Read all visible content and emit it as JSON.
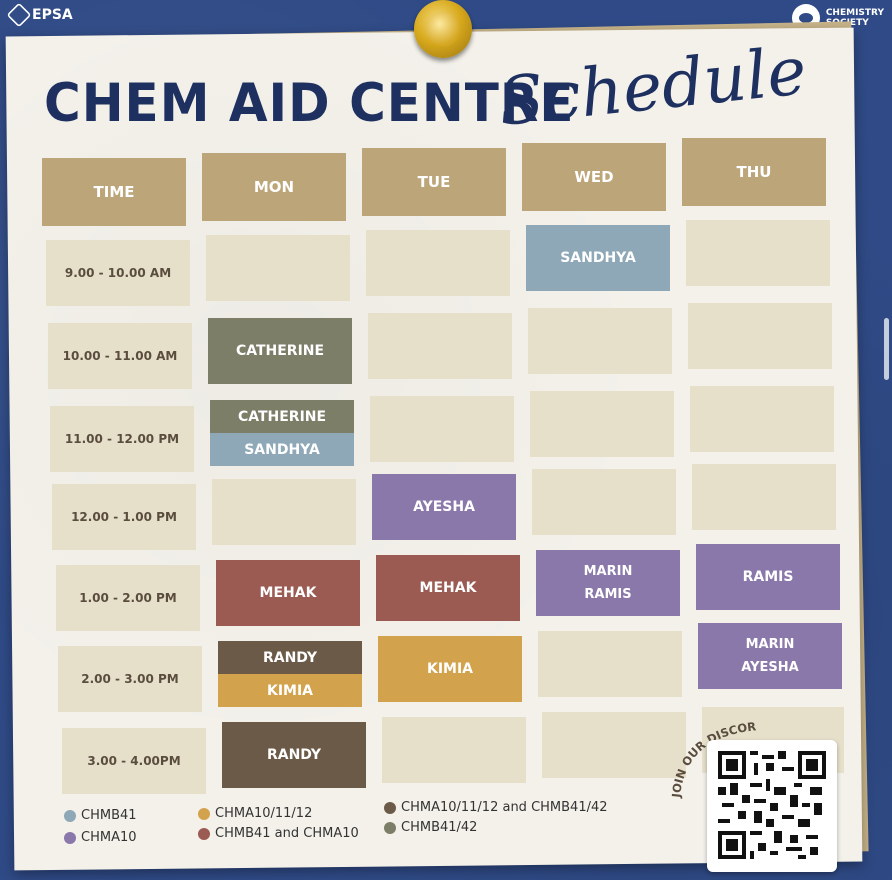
{
  "logos": {
    "left": "EPSA",
    "right_line1": "CHEMISTRY",
    "right_line2": "SOCIETY"
  },
  "title": {
    "main": "CHEM AID CENTRE",
    "script": "Schedule"
  },
  "headers": [
    "TIME",
    "MON",
    "TUE",
    "WED",
    "THU"
  ],
  "times": [
    "9.00 - 10.00 AM",
    "10.00 - 11.00 AM",
    "11.00 - 12.00 PM",
    "12.00 - 1.00 PM",
    "1.00 - 2.00 PM",
    "2.00 - 3.00 PM",
    "3.00 - 4.00PM"
  ],
  "colors": {
    "header": "#bda57a",
    "empty": "#e6e0cb",
    "CHMB41": "#8ea8b8",
    "CHMA10": "#8a78ab",
    "CHMA10_11_12": "#d2a34c",
    "CHMB41_and_CHMA10": "#9b5a52",
    "CHMA10_11_12_and_CHMB41_42": "#6c5a48",
    "CHMB41_42": "#7c7e68"
  },
  "schedule": {
    "r0": {
      "mon": "",
      "tue": "",
      "wed": "SANDHYA",
      "thu": ""
    },
    "r1": {
      "mon": "CATHERINE",
      "tue": "",
      "wed": "",
      "thu": ""
    },
    "r2": {
      "mon_top": "CATHERINE",
      "mon_bottom": "SANDHYA",
      "tue": "",
      "wed": "",
      "thu": ""
    },
    "r3": {
      "mon": "",
      "tue": "AYESHA",
      "wed": "",
      "thu": ""
    },
    "r4": {
      "mon": "MEHAK",
      "tue": "MEHAK",
      "wed_line1": "MARIN",
      "wed_line2": "RAMIS",
      "thu": "RAMIS"
    },
    "r5": {
      "mon_top": "RANDY",
      "mon_bottom": "KIMIA",
      "tue": "KIMIA",
      "wed": "",
      "thu_line1": "MARIN",
      "thu_line2": "AYESHA"
    },
    "r6": {
      "mon": "RANDY",
      "tue": "",
      "wed": "",
      "thu": ""
    }
  },
  "legend": [
    {
      "label": "CHMB41",
      "color": "#8ea8b8"
    },
    {
      "label": "CHMA10",
      "color": "#8a78ab"
    },
    {
      "label": "CHMA10/11/12",
      "color": "#d2a34c"
    },
    {
      "label": "CHMB41 and CHMA10",
      "color": "#9b5a52"
    },
    {
      "label": "CHMA10/11/12 and CHMB41/42",
      "color": "#6c5a48"
    },
    {
      "label": "CHMB41/42",
      "color": "#7c7e68"
    }
  ],
  "qr": {
    "label": "JOIN OUR DISCORD!"
  }
}
